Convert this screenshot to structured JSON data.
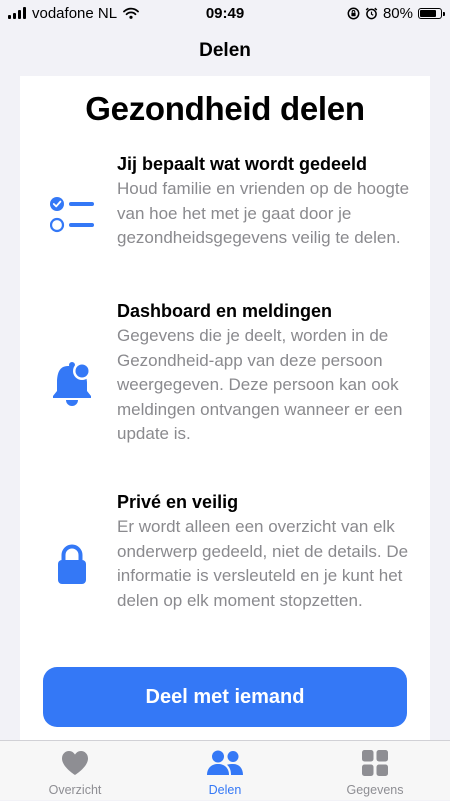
{
  "status_bar": {
    "carrier": "vodafone NL",
    "time": "09:49",
    "battery_percent": "80%",
    "battery_level": 0.8,
    "icons": [
      "signal-icon",
      "wifi-icon",
      "orientation-lock-icon",
      "alarm-icon",
      "battery-icon"
    ]
  },
  "nav": {
    "title": "Delen"
  },
  "main": {
    "title": "Gezondheid delen",
    "features": [
      {
        "icon": "checklist-icon",
        "title": "Jij bepaalt wat wordt gedeeld",
        "description": "Houd familie en vrienden op de hoogte van hoe het met je gaat door je gezondheidsgegevens veilig te delen."
      },
      {
        "icon": "bell-badge-icon",
        "title": "Dashboard en meldingen",
        "description": "Gegevens die je deelt, worden in de Gezondheid-app van deze persoon weergegeven. Deze persoon kan ook meldingen ontvangen wanneer er een update is."
      },
      {
        "icon": "lock-icon",
        "title": "Privé en veilig",
        "description": "Er wordt alleen een overzicht van elk onderwerp gedeeld, niet de details. De informatie is versleuteld en je kunt het delen op elk moment stopzetten."
      }
    ],
    "share_button": "Deel met iemand"
  },
  "tab_bar": {
    "tabs": [
      {
        "label": "Overzicht",
        "icon": "heart-icon",
        "active": false
      },
      {
        "label": "Delen",
        "icon": "people-icon",
        "active": true
      },
      {
        "label": "Gegevens",
        "icon": "grid-icon",
        "active": false
      }
    ]
  },
  "colors": {
    "accent": "#3478f6",
    "secondary_text": "#8a8a8e",
    "inactive_tab": "#8e8e93",
    "background": "#f2f2f7"
  }
}
